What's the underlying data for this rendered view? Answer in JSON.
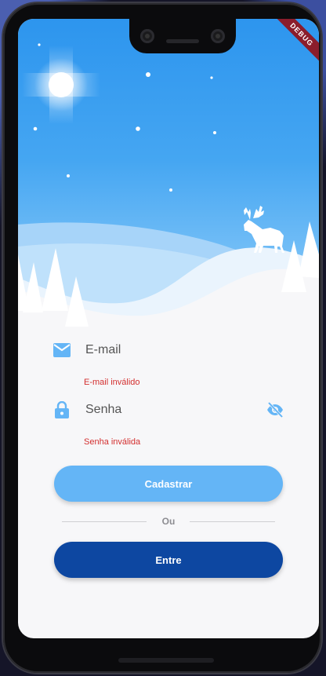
{
  "debug_banner": "DEBUG",
  "form": {
    "email_label": "E-mail",
    "email_error": "E-mail inválido",
    "password_label": "Senha",
    "password_error": "Senha inválida"
  },
  "buttons": {
    "register": "Cadastrar",
    "login": "Entre"
  },
  "divider_text": "Ou",
  "icons": {
    "email": "email-icon",
    "password": "lock-icon",
    "visibility": "visibility-off-icon"
  },
  "colors": {
    "accent": "#64b5f6",
    "primary": "#0d47a1",
    "error": "#d32f2f"
  }
}
